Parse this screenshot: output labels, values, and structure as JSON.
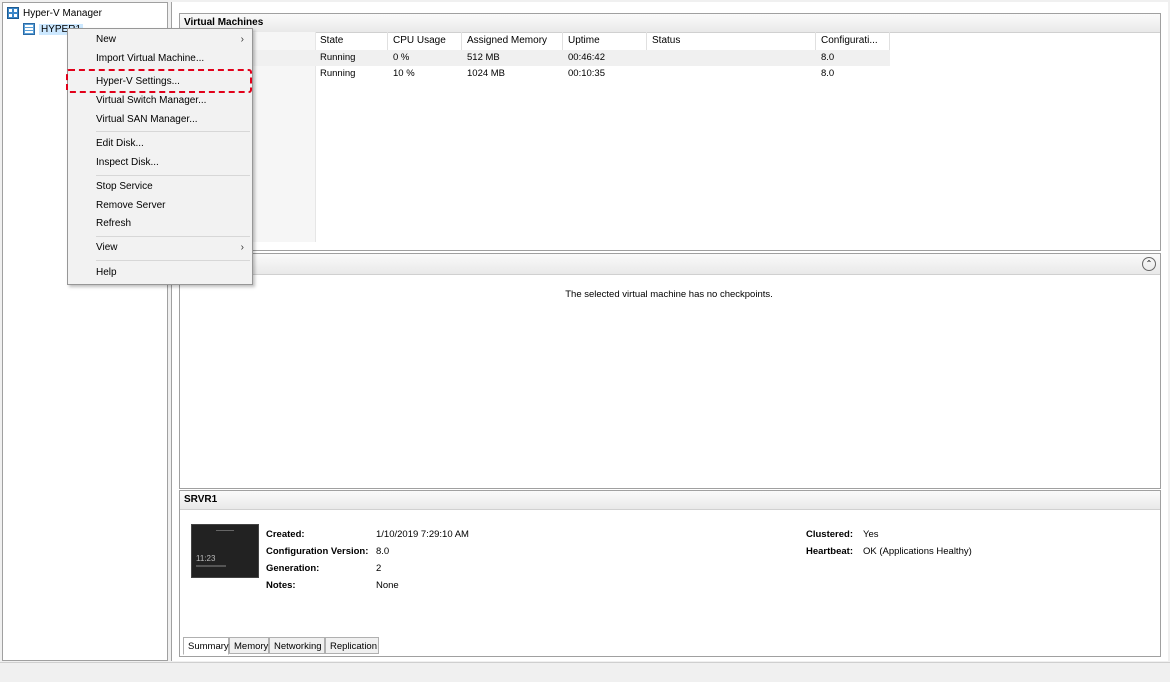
{
  "tree": {
    "root_label": "Hyper-V Manager",
    "server_label": "HYPER1"
  },
  "context_menu": {
    "items": [
      {
        "label": "New",
        "submenu": true
      },
      {
        "label": "Import Virtual Machine..."
      },
      {
        "label": "Hyper-V Settings...",
        "highlighted": true
      },
      {
        "label": "Virtual Switch Manager..."
      },
      {
        "label": "Virtual SAN Manager..."
      },
      {
        "label": "Edit Disk..."
      },
      {
        "label": "Inspect Disk..."
      },
      {
        "label": "Stop Service"
      },
      {
        "label": "Remove Server"
      },
      {
        "label": "Refresh"
      },
      {
        "label": "View",
        "submenu": true
      },
      {
        "label": "Help"
      }
    ],
    "submenu_arrow": "›"
  },
  "virtual_machines": {
    "title": "Virtual Machines",
    "columns": [
      "State",
      "CPU Usage",
      "Assigned Memory",
      "Uptime",
      "Status",
      "Configurati..."
    ],
    "rows": [
      [
        "Running",
        "0 %",
        "512 MB",
        "00:46:42",
        "",
        "8.0"
      ],
      [
        "Running",
        "10 %",
        "1024 MB",
        "00:10:35",
        "",
        "8.0"
      ]
    ]
  },
  "checkpoints": {
    "message": "The selected virtual machine has no checkpoints.",
    "collapse_glyph": "⌃"
  },
  "details": {
    "title": "SRVR1",
    "thumbnail_time": "11:23",
    "left_fields": [
      {
        "label": "Created:",
        "value": "1/10/2019 7:29:10 AM"
      },
      {
        "label": "Configuration Version:",
        "value": "8.0"
      },
      {
        "label": "Generation:",
        "value": "2"
      },
      {
        "label": "Notes:",
        "value": "None"
      }
    ],
    "right_fields": [
      {
        "label": "Clustered:",
        "value": "Yes"
      },
      {
        "label": "Heartbeat:",
        "value": "OK (Applications Healthy)"
      }
    ],
    "tabs": [
      "Summary",
      "Memory",
      "Networking",
      "Replication"
    ],
    "active_tab": "Summary"
  },
  "colors": {
    "highlight_border": "#e2001a",
    "selection": "#cce8ff"
  }
}
